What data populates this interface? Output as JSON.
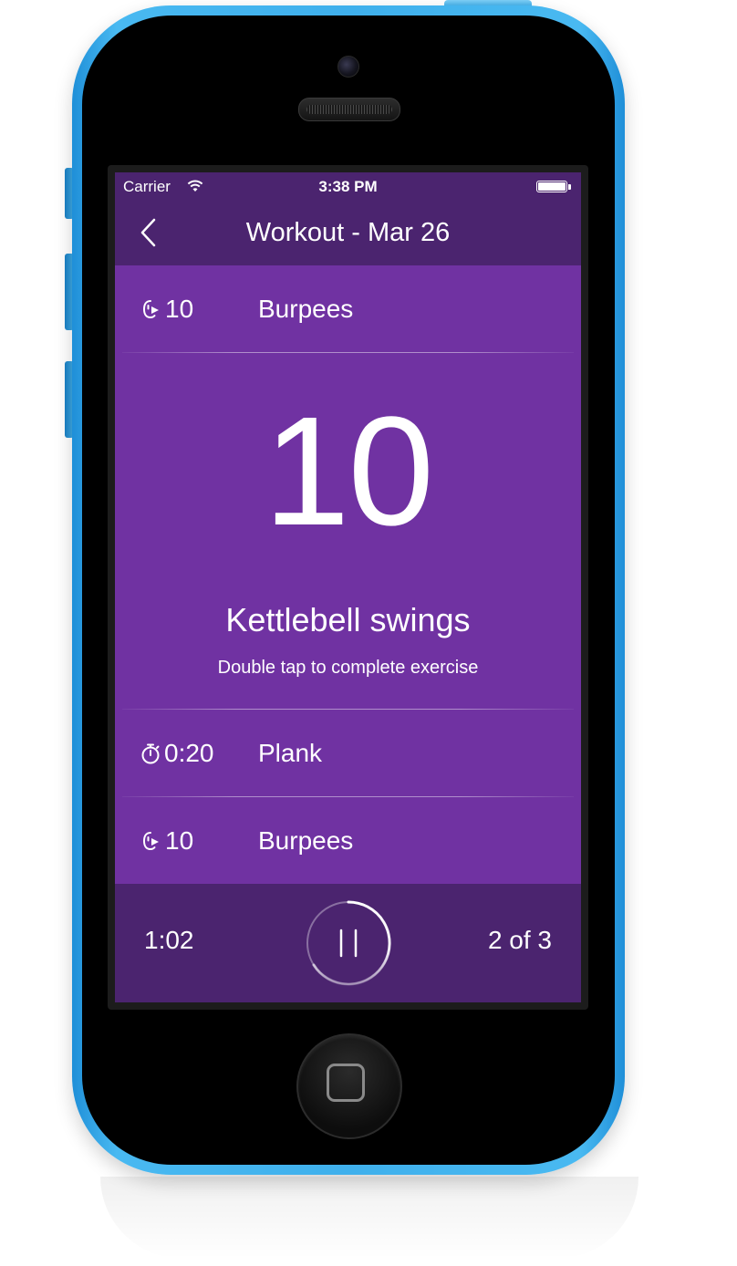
{
  "status_bar": {
    "carrier": "Carrier",
    "time": "3:38 PM",
    "battery_level": 1.0
  },
  "nav": {
    "title": "Workout - Mar 26",
    "back_icon": "chevron-left-icon"
  },
  "exercises": {
    "previous": {
      "icon": "reps-icon",
      "metric": "10",
      "name": "Burpees"
    },
    "current": {
      "count": "10",
      "name": "Kettlebell swings",
      "hint": "Double tap to complete exercise"
    },
    "next": [
      {
        "icon": "stopwatch-icon",
        "metric": "0:20",
        "name": "Plank"
      },
      {
        "icon": "reps-icon",
        "metric": "10",
        "name": "Burpees"
      }
    ]
  },
  "footer": {
    "elapsed": "1:02",
    "pause_icon": "pause-icon",
    "round": "2 of 3"
  },
  "colors": {
    "bar_background": "#4b246f",
    "content_background": "#7032a2",
    "phone_body": "#3fb0ec",
    "text": "#ffffff"
  }
}
